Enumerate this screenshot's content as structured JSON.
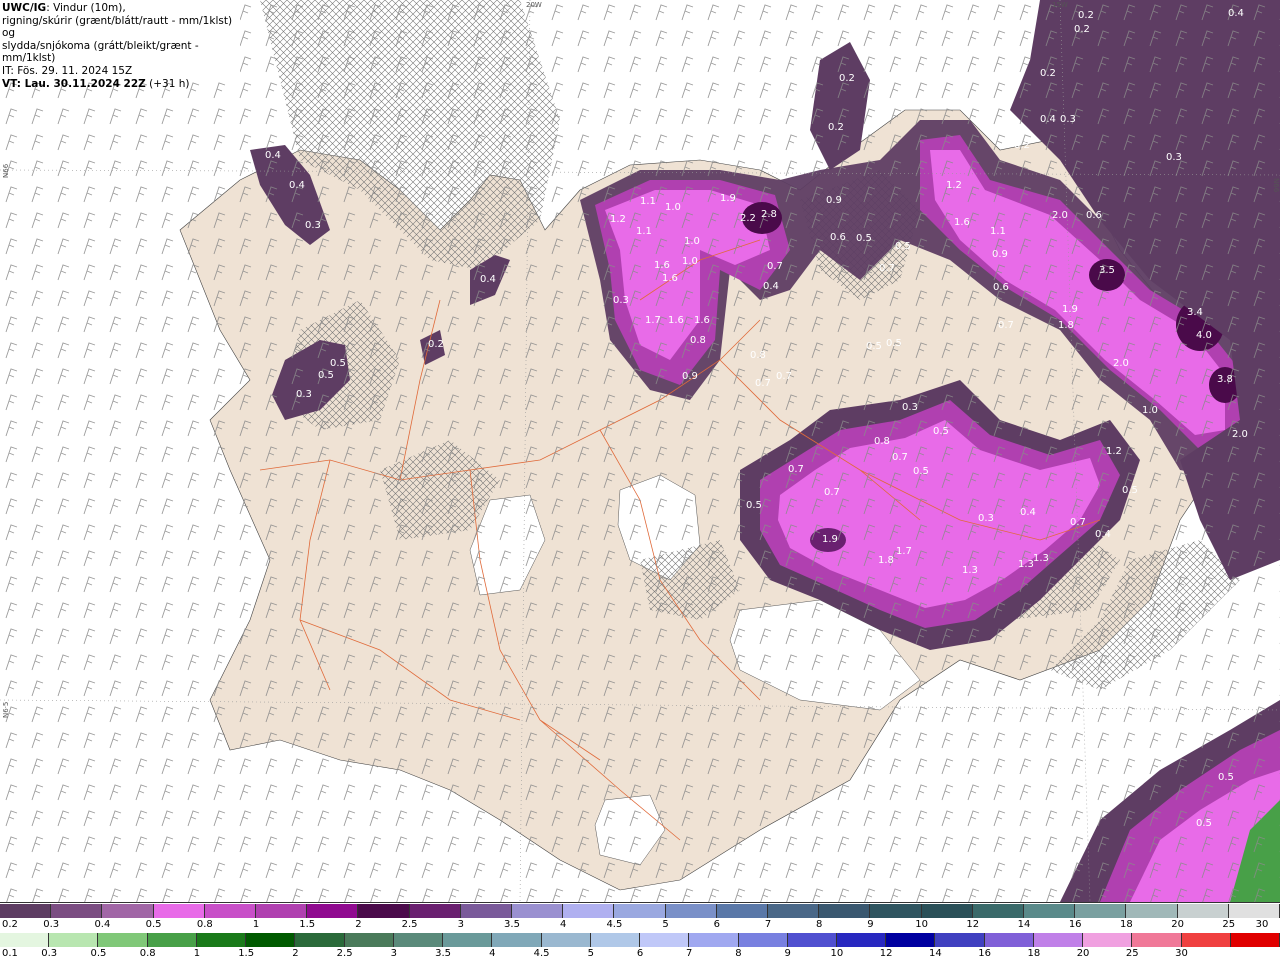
{
  "header": {
    "source": "UWC/IG",
    "line1": ": Vindur (10m),",
    "line2": "rigning/skúrir (grænt/blátt/rautt - mm/1klst) og",
    "line3": "slydda/snjókoma (grátt/bleikt/grænt - mm/1klst)",
    "init_time": "IT: Fös. 29. 11. 2024 15Z",
    "valid_prefix": "VT: Lau. 30.11.2024 22Z",
    "valid_suffix": " (+31 h)"
  },
  "map": {
    "coord_labels": [
      "20W",
      "15W",
      "N66",
      "N66",
      "N6·5"
    ],
    "precip_labels": [
      "0.4",
      "0.4",
      "0.3",
      "0.4",
      "0.5",
      "0.5",
      "0.3",
      "0.2",
      "0.2",
      "0.2",
      "0.2",
      "0.4",
      "0.3",
      "0.3",
      "0.2",
      "0.2",
      "0.2",
      "0.4",
      "0.3",
      "1.2",
      "1.1",
      "1.0",
      "1.1",
      "1.0",
      "1.0",
      "1.6",
      "1.6",
      "1.7",
      "1.6",
      "1.6",
      "0.8",
      "0.9",
      "0.3",
      "1.9",
      "2.2",
      "2.8",
      "0.7",
      "0.4",
      "0.9",
      "0.6",
      "0.5",
      "0.5",
      "0.7",
      "1.2",
      "1.6",
      "1.1",
      "0.9",
      "0.6",
      "2.0",
      "0.6",
      "0.7",
      "3.5",
      "1.9",
      "1.8",
      "3.4",
      "4.0",
      "2.0",
      "3.8",
      "2.0",
      "0.5",
      "0.5",
      "0.8",
      "0.7",
      "0.7",
      "0.3",
      "0.8",
      "0.7",
      "0.5",
      "0.7",
      "0.7",
      "0.5",
      "0.5",
      "1.9",
      "1.8",
      "1.7",
      "1.3",
      "1.3",
      "1.3",
      "0.3",
      "0.4",
      "0.7",
      "0.4",
      "1.2",
      "1.0",
      "0.5",
      "0.5",
      "0.5"
    ]
  },
  "legend": {
    "snow_colors": [
      "#5e3d63",
      "#7b4d82",
      "#a166a6",
      "#e86be8",
      "#c84fc8",
      "#b040b0",
      "#900a90",
      "#4a0a4a",
      "#6a2070",
      "#7a5a9a",
      "#9a90d0",
      "#b0b0f0",
      "#9aa8e0",
      "#7a90c8",
      "#5a78a8",
      "#4a6888",
      "#3a5870",
      "#2f5560",
      "#2a5058",
      "#3a6a6a",
      "#5a8a8a",
      "#7aa0a0",
      "#a0b8b8",
      "#c8d0d0",
      "#e0e0e0"
    ],
    "snow_values": [
      "0.2",
      "0.3",
      "0.4",
      "0.5",
      "0.8",
      "1",
      "1.5",
      "2",
      "2.5",
      "3",
      "3.5",
      "4",
      "4.5",
      "5",
      "6",
      "7",
      "8",
      "9",
      "10",
      "12",
      "14",
      "16",
      "18",
      "20",
      "25",
      "30"
    ],
    "rain_colors": [
      "#e4f6e0",
      "#b8e6b0",
      "#80c878",
      "#48a048",
      "#1a7a1a",
      "#005a00",
      "#2a6a3a",
      "#4a7a5a",
      "#5a8a7a",
      "#6a9a9a",
      "#80a8b8",
      "#9ab8d0",
      "#b0c8e8",
      "#c0c8f8",
      "#a0a8f0",
      "#7880e0",
      "#5050d0",
      "#2828c0",
      "#0000a0",
      "#4040c0",
      "#8060d8",
      "#c080e8",
      "#f0a0e0",
      "#f07898",
      "#f04040",
      "#e00000"
    ],
    "rain_values": [
      "0.1",
      "0.3",
      "0.5",
      "0.8",
      "1",
      "1.5",
      "2",
      "2.5",
      "3",
      "3.5",
      "4",
      "4.5",
      "5",
      "6",
      "7",
      "8",
      "9",
      "10",
      "12",
      "14",
      "16",
      "18",
      "20",
      "25",
      "30"
    ]
  },
  "colors": {
    "land": "#efe2d4",
    "sea": "#ffffff",
    "wind_barb": "#8a8a8a",
    "roads": "#e06a3a",
    "hatch": "#777777",
    "snow_light": "#5e3d63",
    "snow_mid": "#b040b0",
    "snow_pink": "#e86be8",
    "snow_dark": "#3a0f45"
  }
}
